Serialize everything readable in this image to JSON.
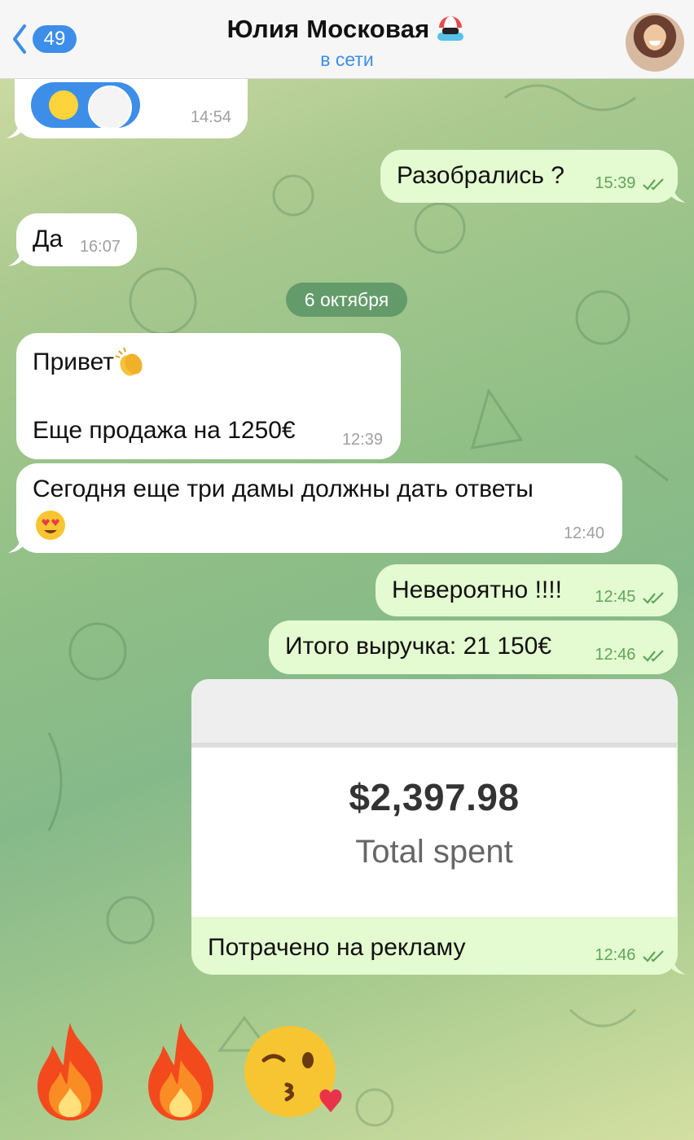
{
  "header": {
    "back_count": "49",
    "contact_name": "Юлия Московая",
    "status": "в сети"
  },
  "messages": [
    {
      "id": "m1",
      "side": "in",
      "type": "sticker_chip",
      "time": "14:54"
    },
    {
      "id": "m2",
      "side": "out",
      "text": "Разобрались ?",
      "time": "15:39",
      "read": true
    },
    {
      "id": "m3",
      "side": "in",
      "text": "Да",
      "time": "16:07"
    },
    {
      "id": "date",
      "type": "date_separator",
      "text": "6 октября"
    },
    {
      "id": "m4",
      "side": "in",
      "line1": "Привет",
      "line2": "Еще продажа на 1250€",
      "time": "12:39"
    },
    {
      "id": "m5",
      "side": "in",
      "text": "Сегодня еще три дамы должны дать ответы",
      "time": "12:40"
    },
    {
      "id": "m6",
      "side": "out",
      "text": "Невероятно !!!!",
      "time": "12:45",
      "read": true
    },
    {
      "id": "m7",
      "side": "out",
      "text": "Итого выручка: 21 150€",
      "time": "12:46",
      "read": true
    },
    {
      "id": "m8",
      "side": "out",
      "type": "image",
      "image_amount": "$2,397.98",
      "image_caption": "Total spent",
      "caption": "Потрачено на рекламу",
      "time": "12:46",
      "read": true
    }
  ],
  "big_emoji": [
    "fire-icon",
    "fire-icon",
    "kiss-wink-icon"
  ],
  "colors": {
    "accent": "#3d8ee8",
    "outgoing_bubble": "#e4fad0",
    "incoming_bubble": "#ffffff",
    "read_ticks": "#5ea65a"
  }
}
